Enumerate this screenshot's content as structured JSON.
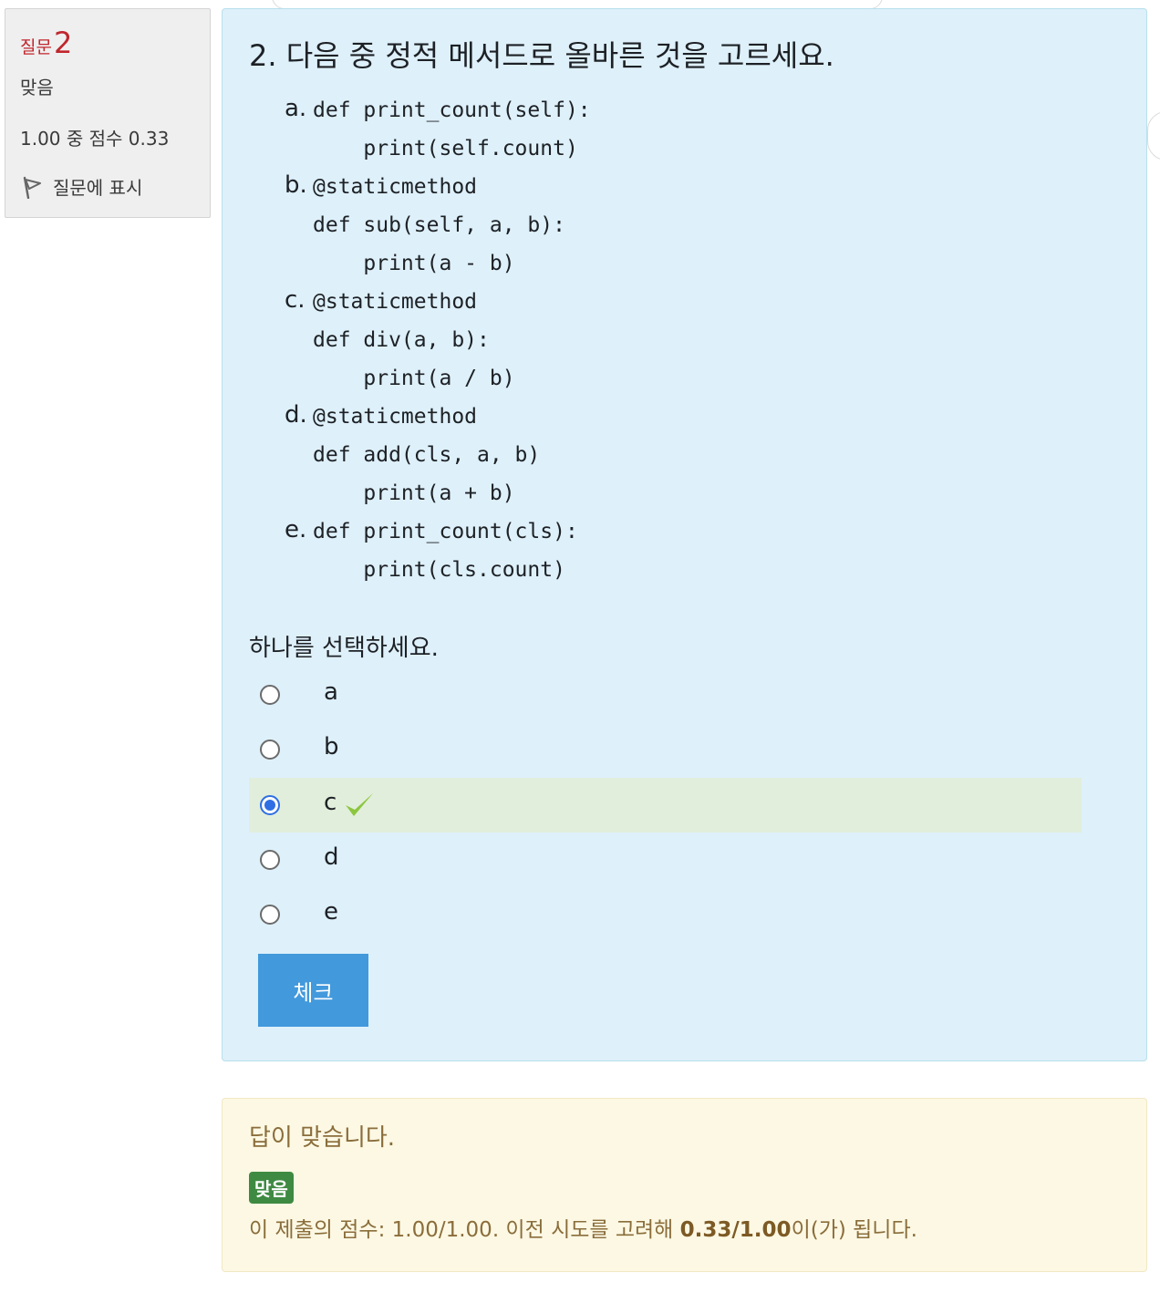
{
  "info": {
    "question_label": "질문",
    "question_number": "2",
    "state": "맞음",
    "grade": "1.00 중 점수 0.33",
    "flag_label": "질문에 표시"
  },
  "question": {
    "text": "2. 다음 중 정적 메서드로 올바른 것을 고르세요.",
    "options": [
      {
        "letter": "a.",
        "lines": [
          "def print_count(self):",
          "    print(self.count)"
        ]
      },
      {
        "letter": "b.",
        "lines": [
          "@staticmethod",
          "def sub(self, a, b):",
          "    print(a - b)"
        ]
      },
      {
        "letter": "c.",
        "lines": [
          "@staticmethod",
          "def div(a, b):",
          "    print(a / b)"
        ]
      },
      {
        "letter": "d.",
        "lines": [
          "@staticmethod",
          "def add(cls, a, b)",
          "    print(a + b)"
        ]
      },
      {
        "letter": "e.",
        "lines": [
          "def print_count(cls):",
          "    print(cls.count)"
        ]
      }
    ]
  },
  "prompt": "하나를 선택하세요.",
  "answers": [
    {
      "label": "a",
      "checked": false,
      "correct": false
    },
    {
      "label": "b",
      "checked": false,
      "correct": false
    },
    {
      "label": "c",
      "checked": true,
      "correct": true
    },
    {
      "label": "d",
      "checked": false,
      "correct": false
    },
    {
      "label": "e",
      "checked": false,
      "correct": false
    }
  ],
  "check_button": "체크",
  "feedback": {
    "message": "답이 맞습니다.",
    "badge": "맞음",
    "grade_prefix": "이 제출의 점수: 1.00/1.00. 이전 시도를 고려해 ",
    "grade_bold": "0.33/1.00",
    "grade_suffix": "이(가) 됩니다."
  },
  "colors": {
    "accent": "#4299dc",
    "correct_bg": "#e1eedb",
    "question_bg": "#def0fa",
    "feedback_bg": "#fcf8e3",
    "qnumber": "#c0262d",
    "badge": "#3f8a42"
  }
}
